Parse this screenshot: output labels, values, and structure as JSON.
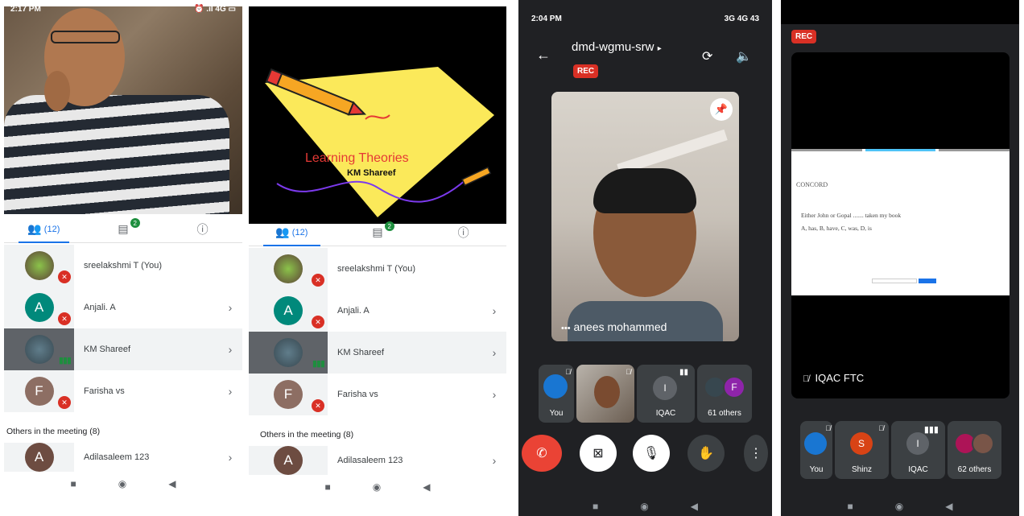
{
  "panel1": {
    "status_time": "2:17 PM",
    "status_icons": "⏰ .ıl 4G ▭",
    "tabs": {
      "people_count": "(12)",
      "chat_badge": "2"
    },
    "participants": [
      {
        "name": "sreelakshmi T (You)",
        "initial": "",
        "muted": true
      },
      {
        "name": "Anjali. A",
        "initial": "A",
        "muted": true
      },
      {
        "name": "KM Shareef",
        "initial": "",
        "muted": false
      },
      {
        "name": "Farisha vs",
        "initial": "F",
        "muted": true
      }
    ],
    "others_label": "Others in the meeting (8)",
    "others": [
      {
        "name": "Adilasaleem 123",
        "initial": "A"
      }
    ]
  },
  "panel2": {
    "slide_title": "Learning Theories",
    "slide_subtitle": "KM Shareef",
    "tabs": {
      "people_count": "(12)",
      "chat_badge": "2"
    },
    "participants": [
      {
        "name": "sreelakshmi T (You)",
        "initial": ""
      },
      {
        "name": "Anjali. A",
        "initial": "A"
      },
      {
        "name": "KM Shareef",
        "initial": ""
      },
      {
        "name": "Farisha vs",
        "initial": "F"
      }
    ],
    "others_label": "Others in the meeting (8)",
    "others": [
      {
        "name": "Adilasaleem 123",
        "initial": "A"
      }
    ]
  },
  "panel3": {
    "status_time": "2:04 PM",
    "status_icons": "3G 4G 43",
    "meeting_code": "dmd-wgmu-srw",
    "rec_label": "REC",
    "main_speaker": "anees mohammed",
    "tiles": [
      {
        "label": "You"
      },
      {
        "label": ""
      },
      {
        "label": "IQAC",
        "initial": "I"
      },
      {
        "label": "61 others",
        "initial": "F"
      }
    ]
  },
  "panel4": {
    "rec_label": "REC",
    "doc_heading": "CONCORD",
    "doc_line1": "Either John or Gopal ....... taken my book",
    "doc_line2": "A, has, B, have, C, was, D, is",
    "presenter_label": "IQAC FTC",
    "tiles": [
      {
        "label": "You"
      },
      {
        "label": "Shinz",
        "initial": "S"
      },
      {
        "label": "IQAC",
        "initial": "I"
      },
      {
        "label": "62 others"
      }
    ]
  },
  "colors": {
    "accent": "#1a73e8",
    "danger": "#d93025",
    "teal": "#00897b",
    "brown": "#8d6e63",
    "dark": "#202124"
  }
}
